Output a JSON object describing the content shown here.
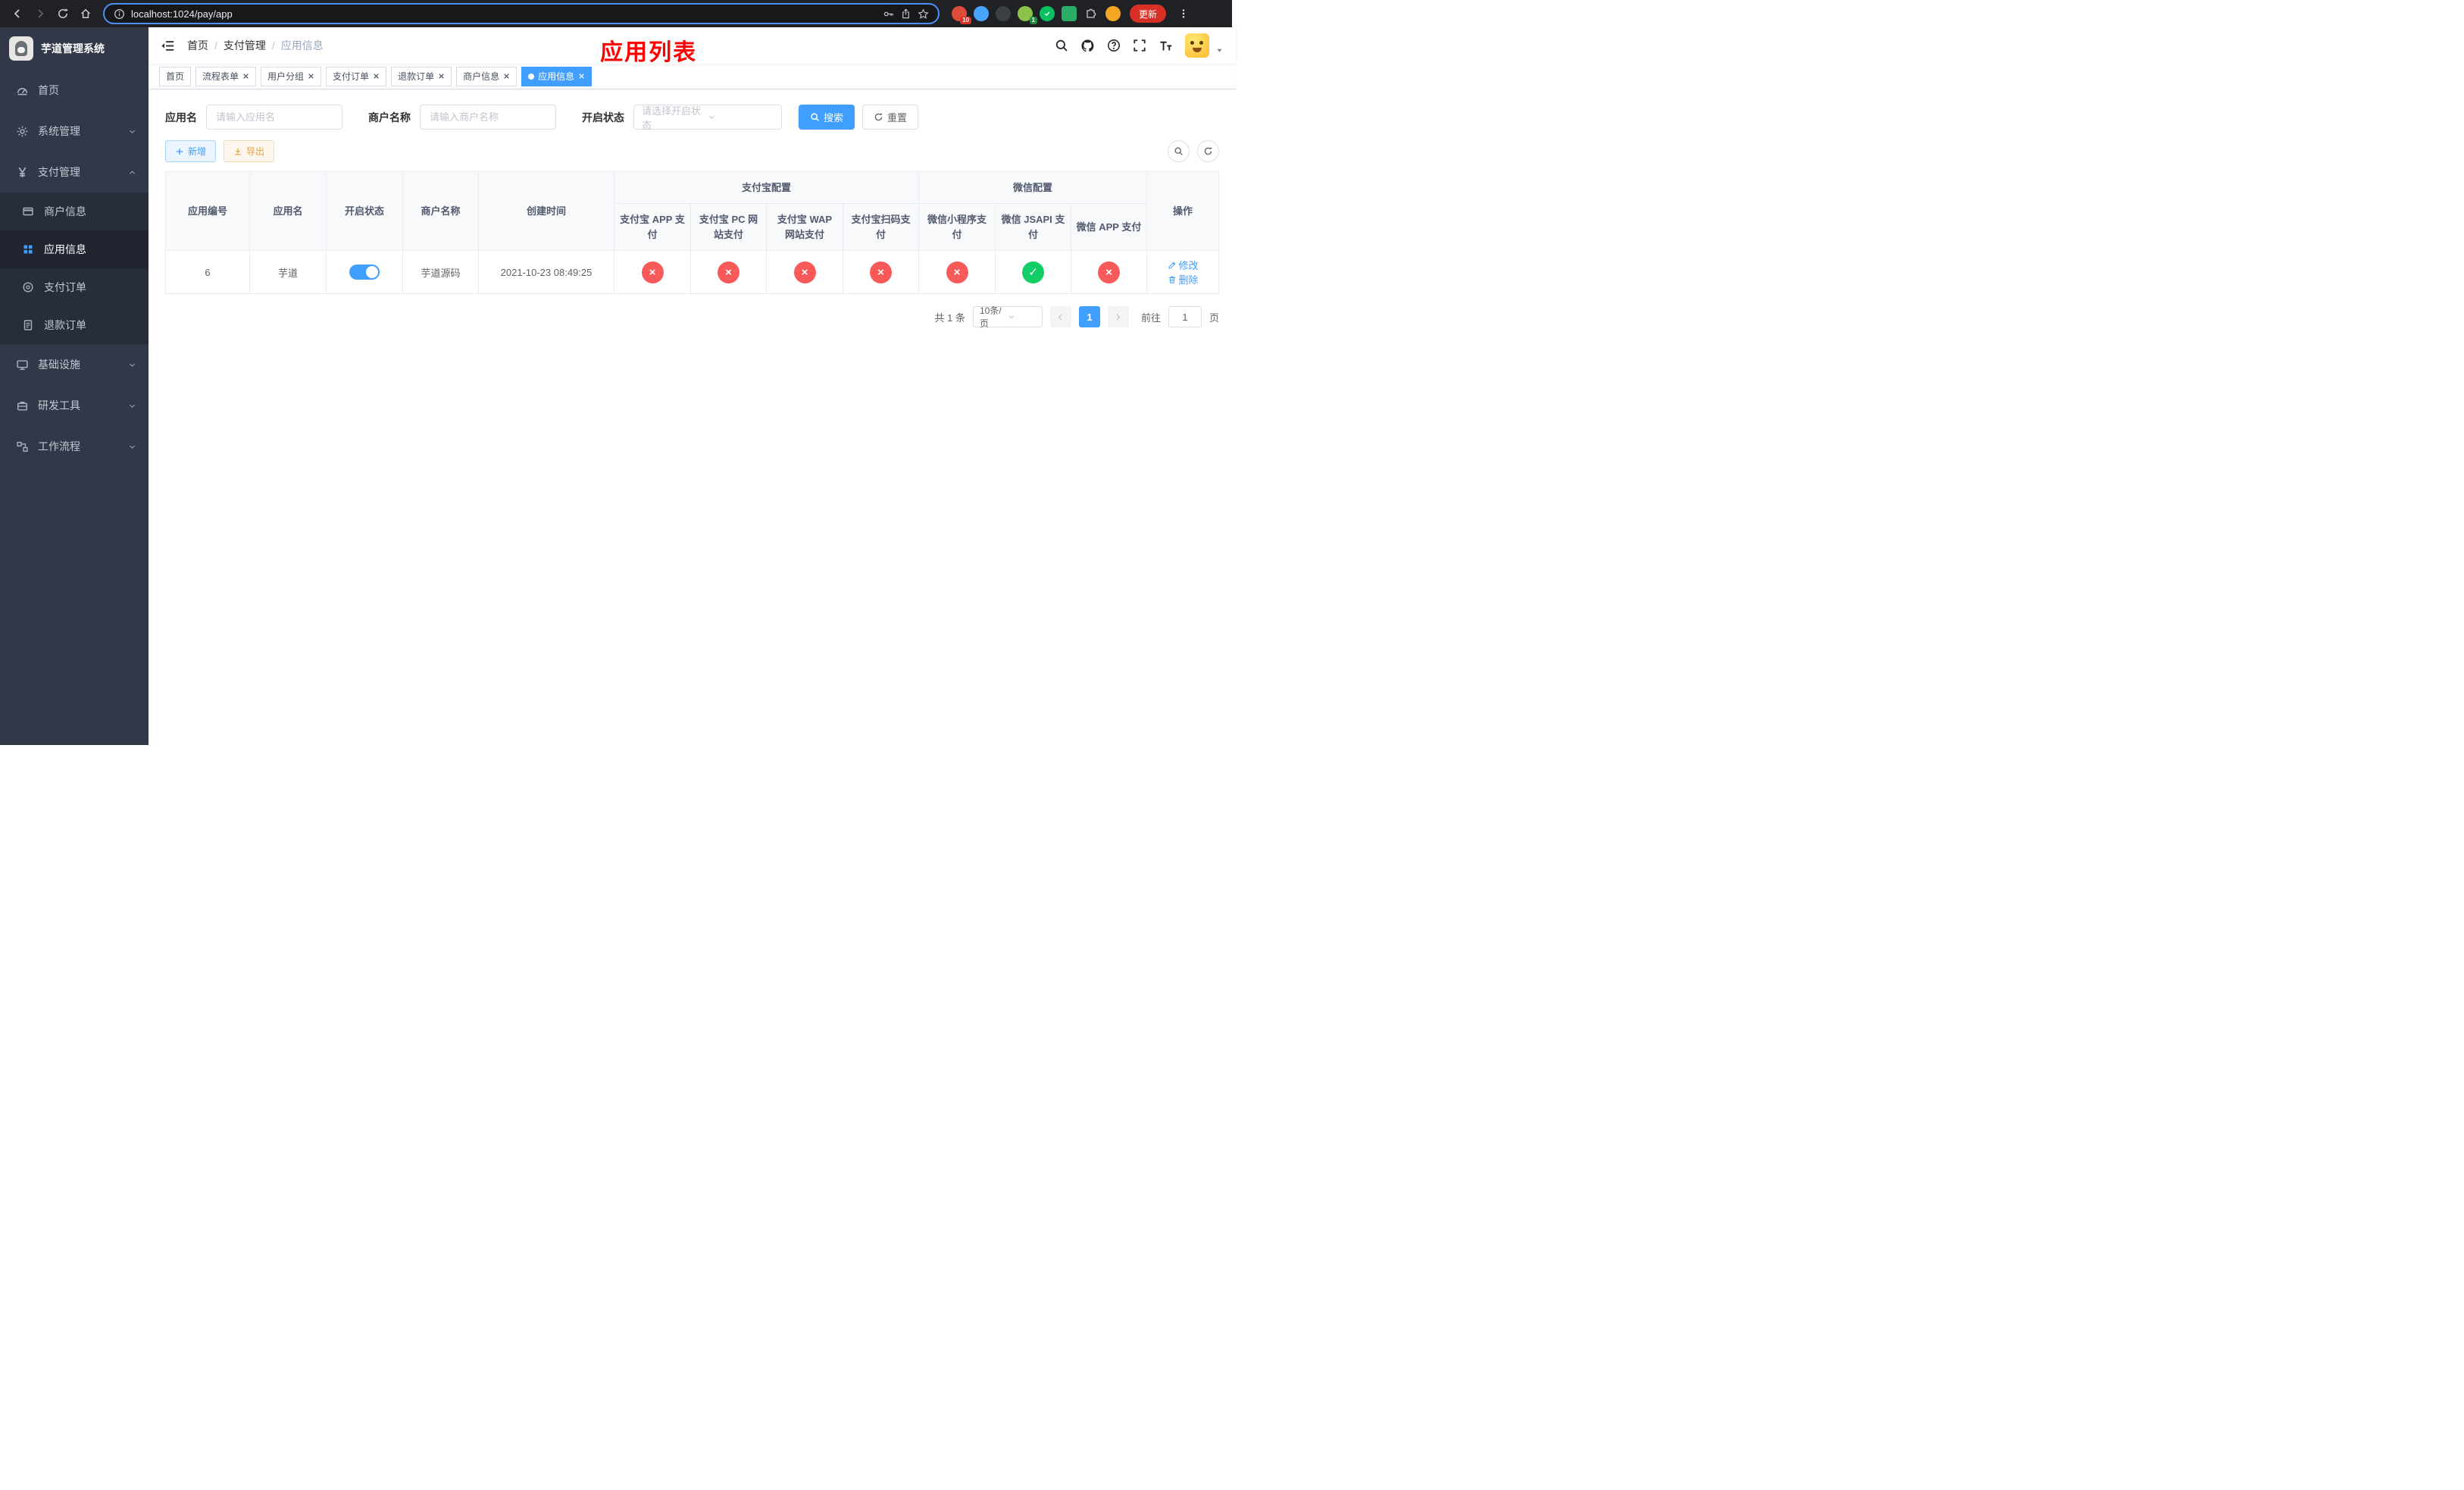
{
  "browser": {
    "url": "localhost:1024/pay/app",
    "update_button": "更新",
    "ext_badge_count": "10",
    "profile_badge_count": "1"
  },
  "annotation": {
    "title": "应用列表"
  },
  "sidebar": {
    "app_title": "芋道管理系统",
    "items": [
      {
        "label": "首页"
      },
      {
        "label": "系统管理"
      },
      {
        "label": "支付管理",
        "children": [
          {
            "label": "商户信息"
          },
          {
            "label": "应用信息"
          },
          {
            "label": "支付订单"
          },
          {
            "label": "退款订单"
          }
        ]
      },
      {
        "label": "基础设施"
      },
      {
        "label": "研发工具"
      },
      {
        "label": "工作流程"
      }
    ]
  },
  "breadcrumb": [
    "首页",
    "支付管理",
    "应用信息"
  ],
  "tabs": [
    {
      "label": "首页"
    },
    {
      "label": "流程表单"
    },
    {
      "label": "用户分组"
    },
    {
      "label": "支付订单"
    },
    {
      "label": "退款订单"
    },
    {
      "label": "商户信息"
    },
    {
      "label": "应用信息"
    }
  ],
  "filters": {
    "app_name_label": "应用名",
    "app_name_placeholder": "请输入应用名",
    "merchant_label": "商户名称",
    "merchant_placeholder": "请输入商户名称",
    "status_label": "开启状态",
    "status_placeholder": "请选择开启状态",
    "search_button": "搜索",
    "reset_button": "重置"
  },
  "toolbar": {
    "add_button": "新增",
    "export_button": "导出"
  },
  "table": {
    "col_id": "应用编号",
    "col_name": "应用名",
    "col_status": "开启状态",
    "col_merchant": "商户名称",
    "col_created": "创建时间",
    "group_alipay": "支付宝配置",
    "group_wechat": "微信配置",
    "col_op": "操作",
    "sub_headers": [
      "支付宝 APP 支付",
      "支付宝 PC 网站支付",
      "支付宝 WAP 网站支付",
      "支付宝扫码支付",
      "微信小程序支付",
      "微信 JSAPI 支付",
      "微信 APP 支付"
    ],
    "rows": [
      {
        "id": "6",
        "name": "芋道",
        "enabled": true,
        "merchant": "芋道源码",
        "created": "2021-10-23 08:49:25",
        "statuses": [
          false,
          false,
          false,
          false,
          false,
          true,
          false
        ],
        "edit_label": "修改",
        "delete_label": "删除"
      }
    ]
  },
  "pagination": {
    "total": "共 1 条",
    "page_size": "10条/页",
    "current_page": "1",
    "goto_label": "前往",
    "goto_value": "1",
    "page_unit": "页"
  },
  "colors": {
    "primary": "#409EFF",
    "success": "#13CE66",
    "danger": "#F85A5A",
    "warning": "#E6A23C",
    "annotation_red": "#FF0000"
  }
}
